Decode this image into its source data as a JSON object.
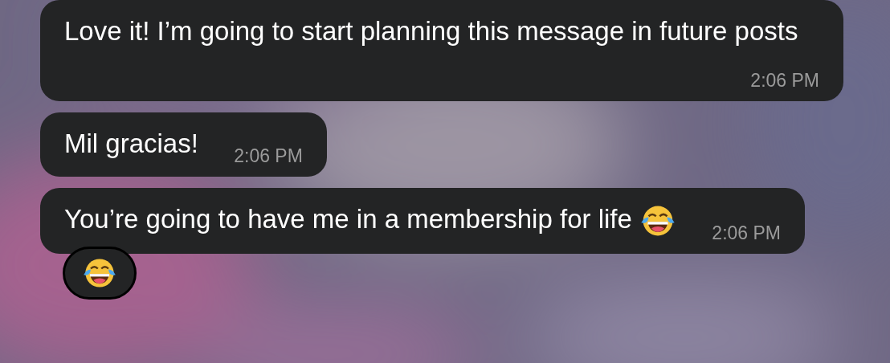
{
  "messages": [
    {
      "text": "Love it! I’m going to start planning this message in future posts",
      "time": "2:06 PM"
    },
    {
      "text": "Mil gracias!",
      "time": "2:06 PM"
    },
    {
      "text": "You’re going to have me in a membership for life",
      "emoji": {
        "kind": "laughing"
      },
      "time": "2:06 PM",
      "reaction": {
        "kind": "laughing"
      }
    }
  ]
}
